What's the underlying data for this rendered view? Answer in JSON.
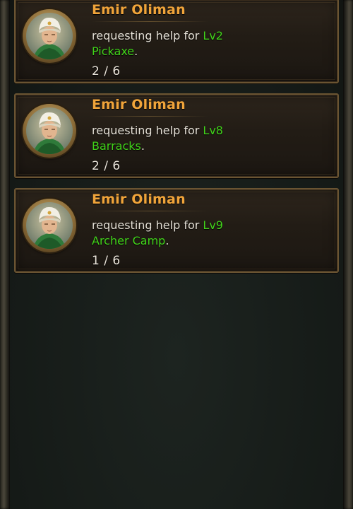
{
  "help_requests": [
    {
      "requester": "Emir Oliman",
      "prefix": "requesting help for",
      "level": "Lv2",
      "target": "Pickaxe",
      "suffix": ".",
      "progress": "2 / 6"
    },
    {
      "requester": "Emir Oliman",
      "prefix": "requesting help for",
      "level": "Lv8",
      "target": "Barracks",
      "suffix": ".",
      "progress": "2 / 6"
    },
    {
      "requester": "Emir Oliman",
      "prefix": "requesting help for",
      "level": "Lv9",
      "target": "Archer Camp",
      "suffix": ".",
      "progress": "1 / 6"
    }
  ],
  "colors": {
    "name": "#f0a43a",
    "highlight": "#41d41a",
    "text": "#e5e0d6",
    "card_border": "#6a5432"
  },
  "icons": {
    "avatar": "hero-portrait-icon"
  }
}
